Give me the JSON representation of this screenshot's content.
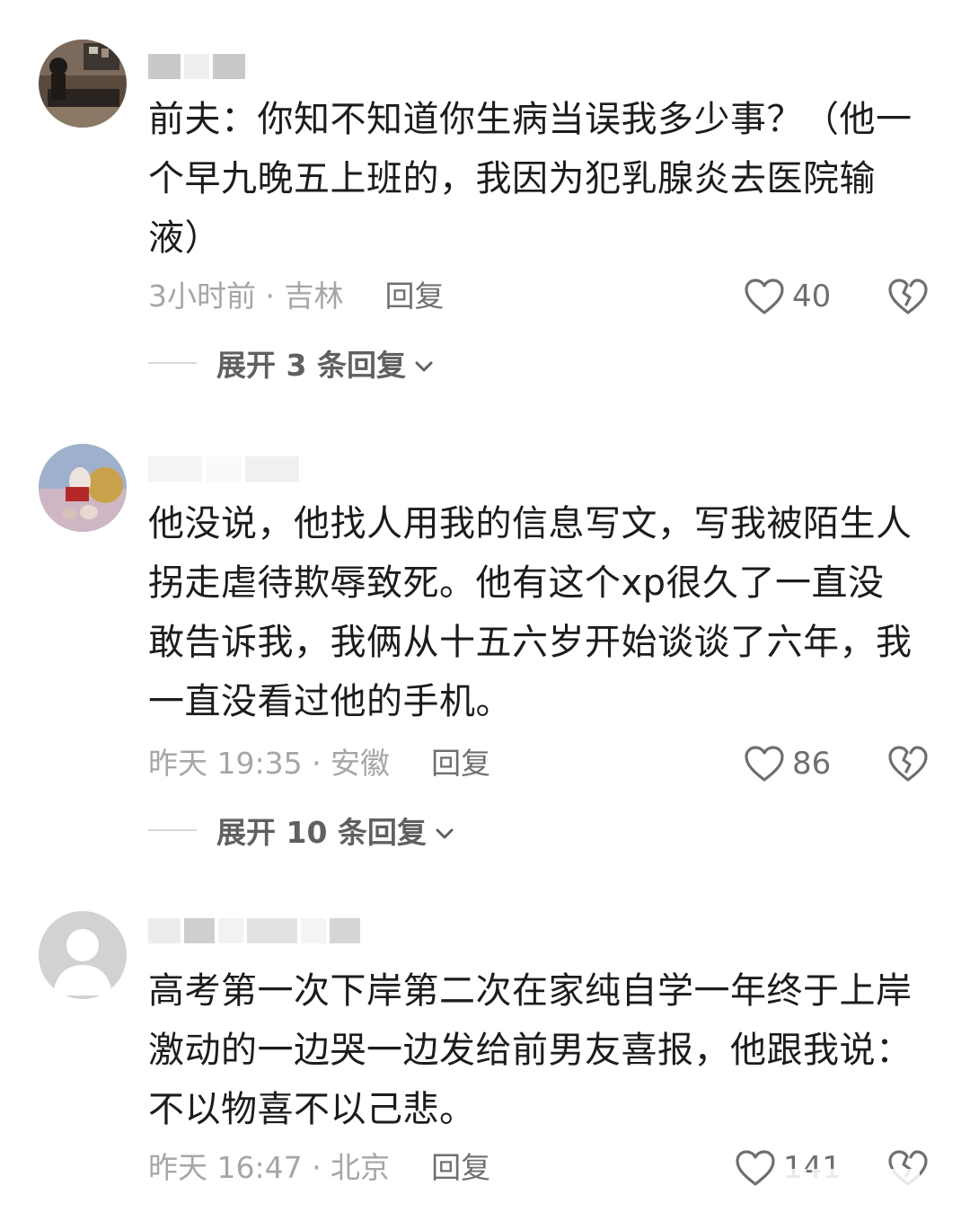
{
  "comments": [
    {
      "text": "前夫：你知不知道你生病当误我多少事？（他一个早九晚五上班的，我因为犯乳腺炎去医院输液）",
      "meta": "3小时前 · 吉林",
      "reply_label": "回复",
      "likes": "40",
      "expand_label": "展开 3 条回复"
    },
    {
      "text": "他没说，他找人用我的信息写文，写我被陌生人拐走虐待欺辱致死。他有这个xp很久了一直没敢告诉我，我俩从十五六岁开始谈谈了六年，我一直没看过他的手机。",
      "meta": "昨天 19:35 · 安徽",
      "reply_label": "回复",
      "likes": "86",
      "expand_label": "展开 10 条回复"
    },
    {
      "text": "高考第一次下岸第二次在家纯自学一年终于上岸激动的一边哭一边发给前男友喜报，他跟我说：不以物喜不以己悲。",
      "meta": "昨天 16:47 · 北京",
      "reply_label": "回复",
      "likes": "141"
    }
  ],
  "icons": {
    "like": "heart-outline-icon",
    "dislike": "broken-heart-icon",
    "expand": "chevron-down-icon"
  },
  "colors": {
    "text": "#1c1c1c",
    "meta": "#a6a6a6",
    "action": "#6f6f6f"
  }
}
